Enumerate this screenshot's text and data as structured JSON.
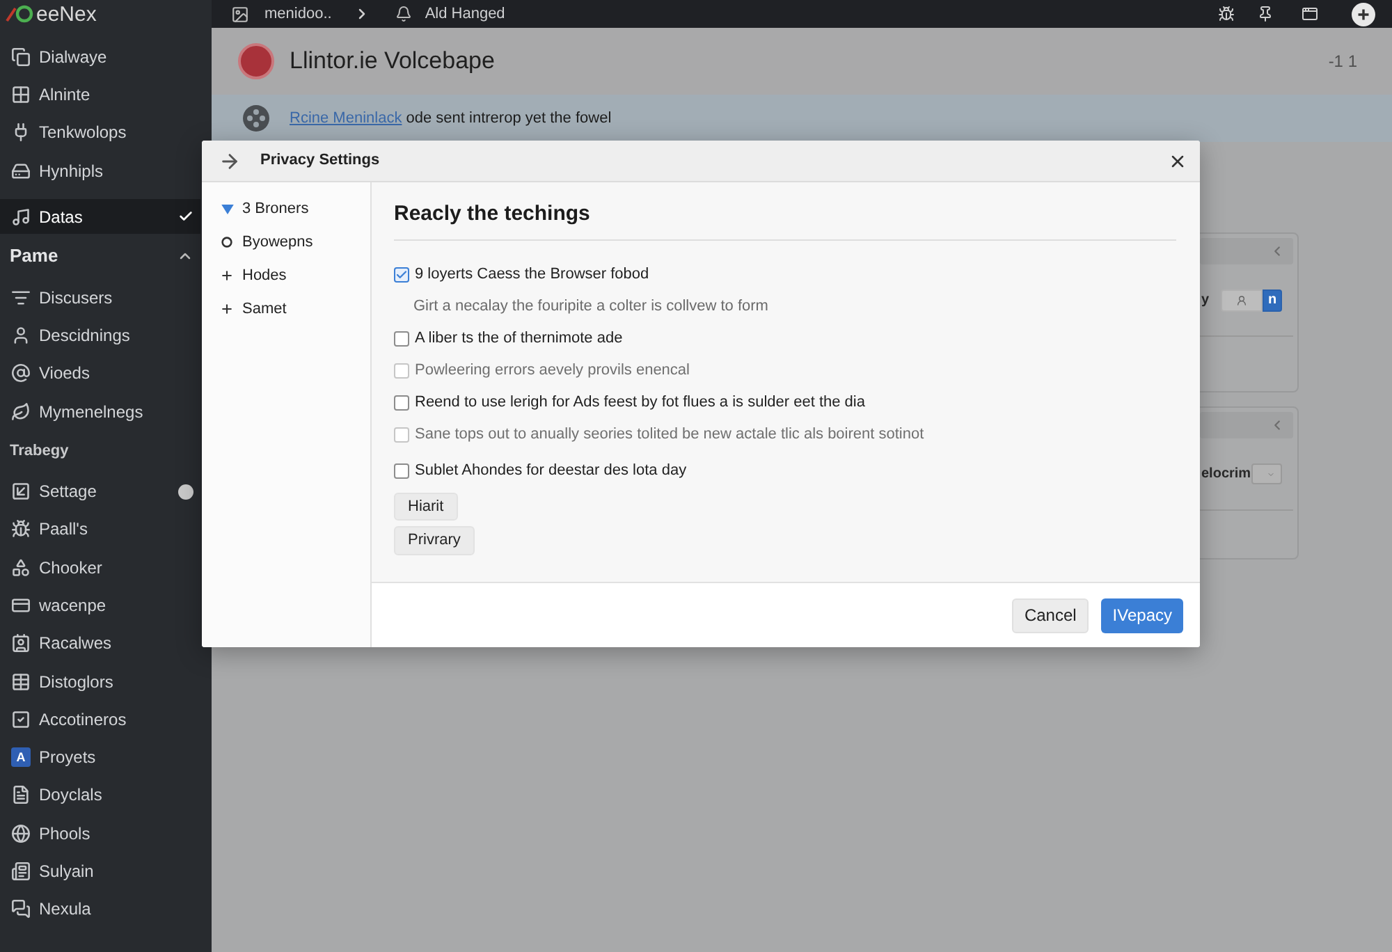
{
  "sidebar": {
    "logo": "eeNex",
    "entries": [
      {
        "kind": "item",
        "label": "Dialwaye",
        "selected": false,
        "unread": false
      },
      {
        "kind": "item",
        "label": "Alninte",
        "selected": false,
        "unread": false
      },
      {
        "kind": "item",
        "label": "Tenkwolops",
        "selected": false,
        "unread": false
      },
      {
        "kind": "item",
        "label": "Hynhipls",
        "selected": false,
        "unread": false
      },
      {
        "kind": "item",
        "label": "Datas",
        "selected": true,
        "unread": false
      },
      {
        "kind": "section",
        "label": "Pame",
        "expanded": true
      },
      {
        "kind": "item",
        "label": "Discusers",
        "selected": false,
        "unread": false
      },
      {
        "kind": "item",
        "label": "Descidnings",
        "selected": false,
        "unread": false
      },
      {
        "kind": "item",
        "label": "Vioeds",
        "selected": false,
        "unread": false
      },
      {
        "kind": "item",
        "label": "Mymenelnegs",
        "selected": false,
        "unread": false
      },
      {
        "kind": "label",
        "label": "Trabegy"
      },
      {
        "kind": "item",
        "label": "Settage",
        "selected": false,
        "unread": true
      },
      {
        "kind": "item",
        "label": "Paall's",
        "selected": false,
        "unread": false
      },
      {
        "kind": "item",
        "label": "Chooker",
        "selected": false,
        "unread": false
      },
      {
        "kind": "item",
        "label": "wacenpe",
        "selected": false,
        "unread": false
      },
      {
        "kind": "item",
        "label": "Racalwes",
        "selected": false,
        "unread": false
      },
      {
        "kind": "item",
        "label": "Distoglors",
        "selected": false,
        "unread": false
      },
      {
        "kind": "item",
        "label": "Accotineros",
        "selected": false,
        "unread": false
      },
      {
        "kind": "item",
        "label": "Proyets",
        "letter": "A",
        "selected": false,
        "unread": false
      },
      {
        "kind": "item",
        "label": "Doyclals",
        "selected": false,
        "unread": false
      },
      {
        "kind": "item",
        "label": "Phools",
        "selected": false,
        "unread": false
      },
      {
        "kind": "item",
        "label": "Sulyain",
        "selected": false,
        "unread": false
      },
      {
        "kind": "item",
        "label": "Nexula",
        "selected": false,
        "unread": false
      }
    ]
  },
  "top_bar": {
    "breadcrumbs": [
      "menidoo..",
      "Ald Hanged"
    ]
  },
  "header": {
    "title": "Llintor.ie Volcebape",
    "counter": "-1 1"
  },
  "banner": {
    "link": "Rcine Meninlack",
    "text": "ode sent intrerop yet the fowel"
  },
  "background_cards": [
    {
      "row_label": "y",
      "control": {
        "kind": "segmented",
        "segments": [
          {
            "selected": false
          },
          {
            "label": "n",
            "selected": true
          }
        ]
      }
    },
    {
      "row_label": "elocrim",
      "control": {
        "kind": "select"
      }
    }
  ],
  "dialog": {
    "title": "Privacy Settings",
    "nav": [
      {
        "label": "3 Broners",
        "kind": "folder",
        "expanded": true
      },
      {
        "label": "Byowepns",
        "kind": "option"
      },
      {
        "label": "Hodes",
        "kind": "folder",
        "expanded": false
      },
      {
        "label": "Samet",
        "kind": "folder",
        "expanded": false
      }
    ],
    "heading": "Reacly the techings",
    "options": [
      {
        "label": "9 loyerts Caess the Browser fobod",
        "checked": true,
        "disabled": false,
        "description": "Girt a necalay the fouripite a colter is collvew to form"
      },
      {
        "label": "A liber ts the of thernimote ade",
        "checked": false,
        "disabled": false
      },
      {
        "label": "Powleering errors aevely provils enencal",
        "checked": false,
        "disabled": true
      },
      {
        "label": "Reend to use lerigh for Ads feest by fot flues a is sulder eet the dia",
        "checked": false,
        "disabled": false
      },
      {
        "label": "Sane tops out to anually seories tolited be new actale tlic als boirent sotinot",
        "checked": false,
        "disabled": true
      },
      {
        "label": "Sublet Ahondes for deestar des lota day",
        "checked": false,
        "disabled": false
      }
    ],
    "actions": [
      "Hiarit",
      "Privrary"
    ],
    "footer_buttons": [
      {
        "label": "Cancel",
        "kind": "secondary"
      },
      {
        "label": "IVepacy",
        "kind": "primary"
      }
    ]
  }
}
